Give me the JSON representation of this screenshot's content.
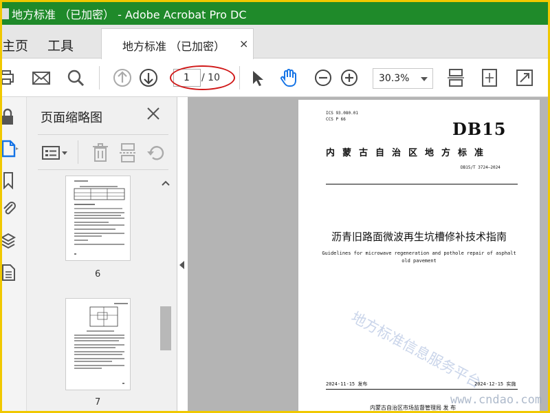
{
  "window": {
    "title": "地方标准  （已加密）  - Adobe Acrobat Pro DC",
    "accent": "#1f8a2a"
  },
  "nav": {
    "home": "主页",
    "tools": "工具"
  },
  "tab": {
    "label": "地方标准  （已加密）",
    "close": "×"
  },
  "toolbar": {
    "page_current": "1",
    "page_total": "/ 10",
    "zoom": "30.3%",
    "icons": [
      "print-icon",
      "mail-icon",
      "search-icon",
      "prev-page-icon",
      "next-page-icon",
      "select-arrow-icon",
      "hand-tool-icon",
      "zoom-out-icon",
      "zoom-in-icon",
      "fit-width-icon",
      "fit-page-icon",
      "fullscreen-icon"
    ]
  },
  "thumbnails_panel": {
    "title": "页面缩略图",
    "pages": [
      {
        "number": "6"
      },
      {
        "number": "7"
      }
    ]
  },
  "document": {
    "ics": "ICS  93.080.01",
    "ccs": "CCS  P  66",
    "db_code": "DB15",
    "org": "内蒙古自治区地方标准",
    "std_number": "DB15/T 3724—2024",
    "title_cn": "沥青旧路面微波再生坑槽修补技术指南",
    "title_en_line1": "Guidelines for microwave regeneration and pothole repair of asphalt",
    "title_en_line2": "old pavement",
    "publish_date": "2024-11-15 发布",
    "effective_date": "2024-12-15 实施",
    "publisher": "内蒙古自治区市场监督管理局    发 布",
    "watermark": "地方标准信息服务平台"
  },
  "site_watermark": "www.cndao.com"
}
